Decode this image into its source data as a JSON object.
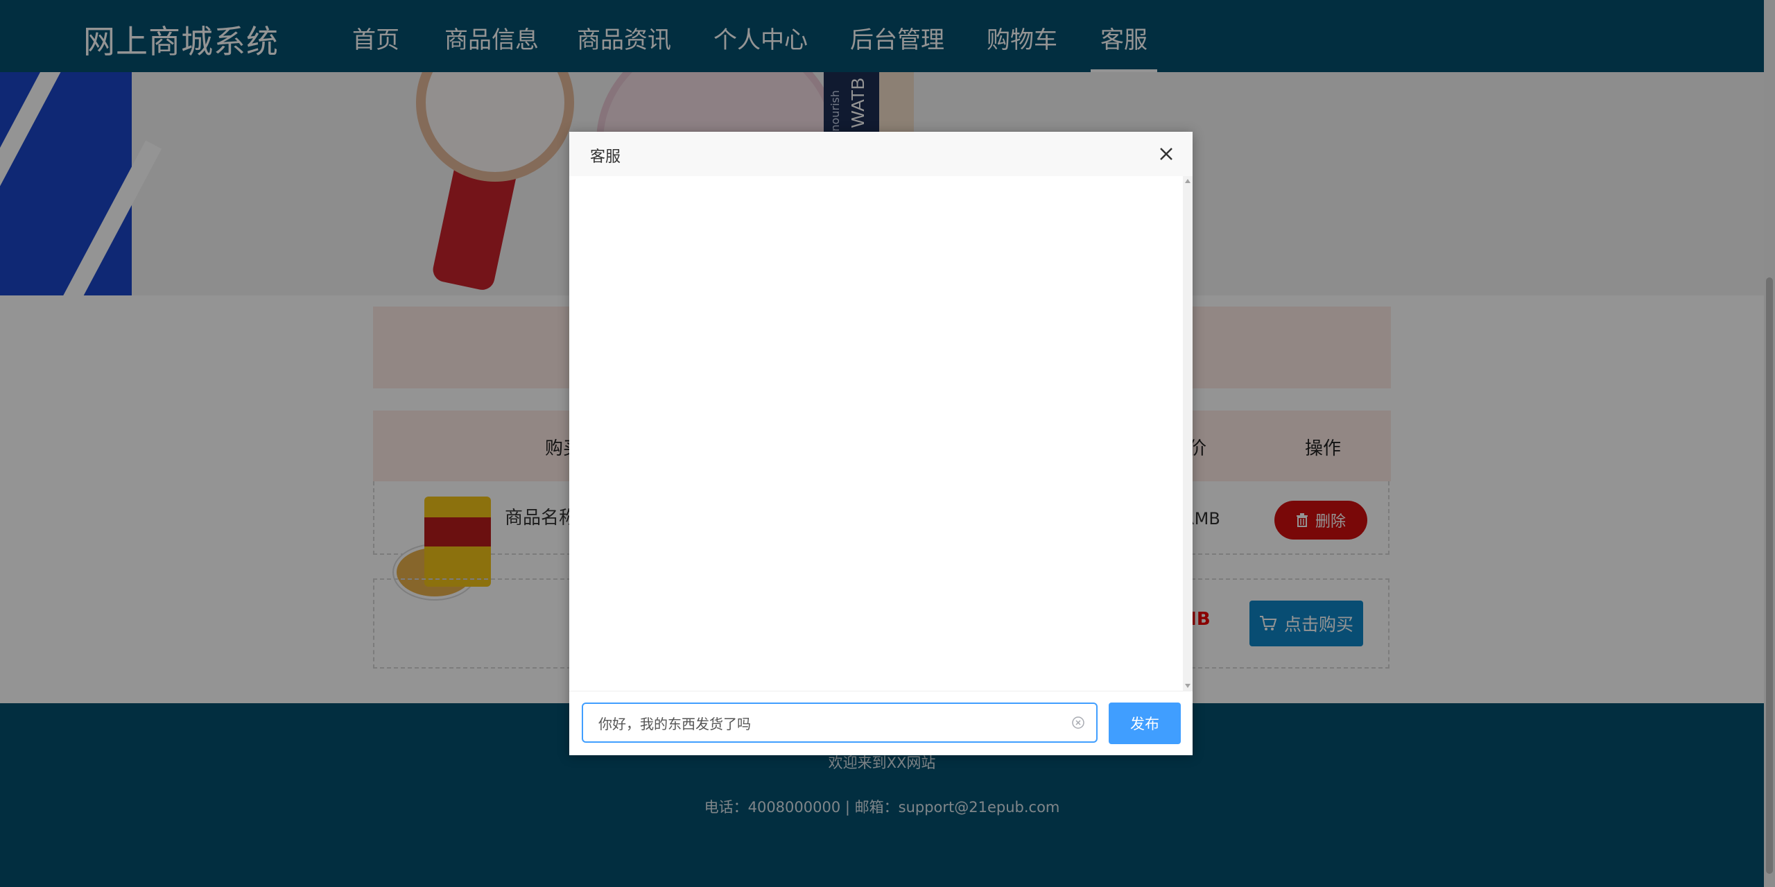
{
  "nav": {
    "brand": "网上商城系统",
    "items": [
      {
        "label": "首页"
      },
      {
        "label": "商品信息"
      },
      {
        "label": "商品资讯"
      },
      {
        "label": "个人中心"
      },
      {
        "label": "后台管理"
      },
      {
        "label": "购物车"
      },
      {
        "label": "客服"
      }
    ],
    "active_item": "客服"
  },
  "banner": {
    "product_text": "WATB",
    "product_subtext": "nourish"
  },
  "cart": {
    "headers": {
      "product": "购买",
      "price": "价",
      "action": "操作"
    },
    "item": {
      "name": "商品名称",
      "price": "RMB",
      "delete_label": "删除"
    },
    "total": {
      "price": "MB",
      "buy_label": "点击购买"
    }
  },
  "footer": {
    "welcome": "欢迎来到XX网站",
    "contact": "电话：4008000000 | 邮箱：support@21epub.com"
  },
  "modal": {
    "title": "客服",
    "input_value": "你好，我的东西发货了吗",
    "publish_label": "发布"
  },
  "colors": {
    "nav_bg": "#04506e",
    "accent": "#409eff",
    "delete": "#d10e0e",
    "buy": "#0f86c6",
    "header_pink": "#fce8e3"
  }
}
